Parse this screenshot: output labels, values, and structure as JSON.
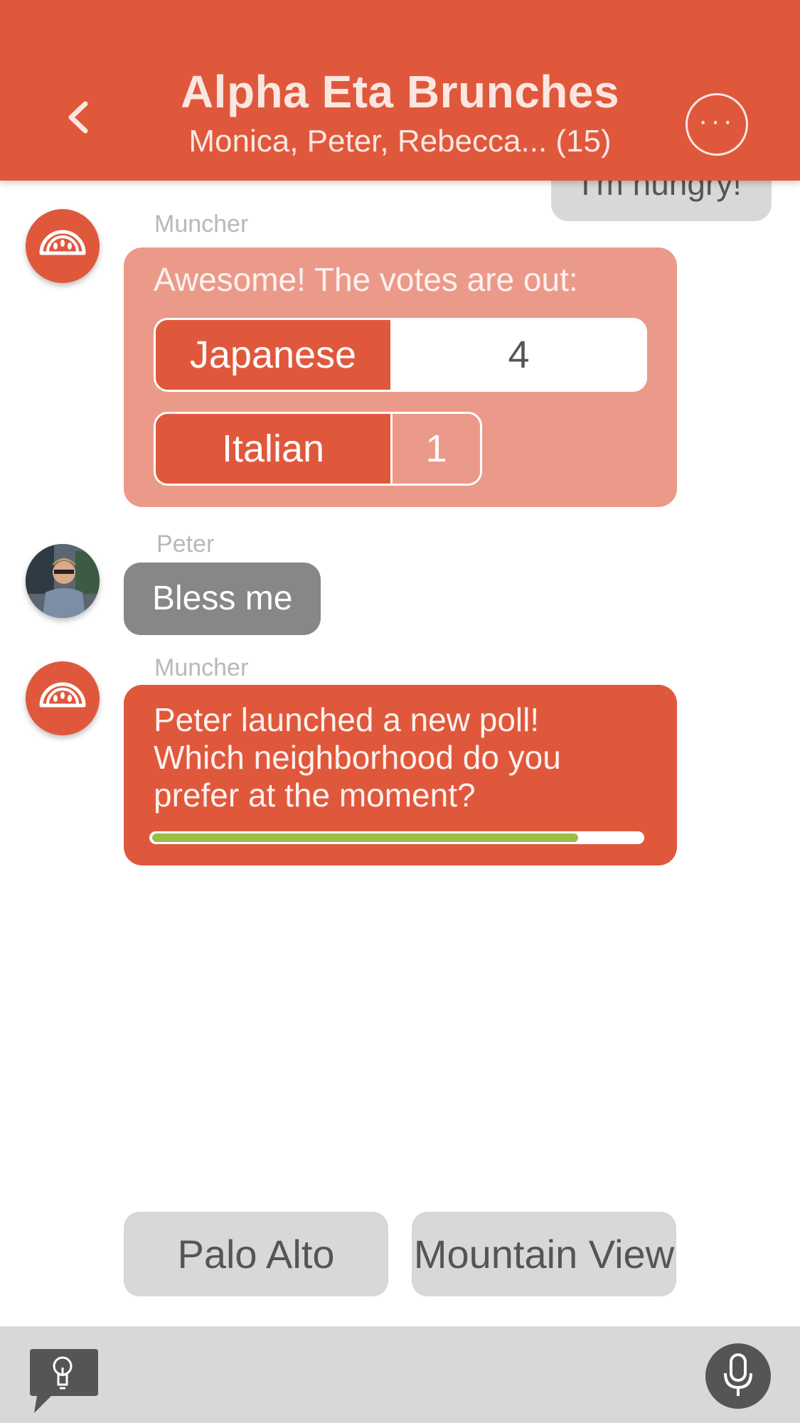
{
  "header": {
    "title": "Alpha Eta Brunches",
    "subtitle": "Monica, Peter, Rebecca... (15)",
    "more_label": "···"
  },
  "messages": {
    "previous_partial": "I'm hungry!",
    "bot_sender": "Muncher",
    "results_prompt": "Awesome! The votes are out:",
    "votes": [
      {
        "label": "Japanese",
        "count": "4"
      },
      {
        "label": "Italian",
        "count": "1"
      }
    ],
    "peter_sender": "Peter",
    "peter_text": "Bless me",
    "bot_sender_2": "Muncher",
    "poll_lines": [
      "Peter launched a new poll!",
      "Which neighborhood do you",
      "prefer at the moment?"
    ],
    "poll_progress": 0.87
  },
  "options": [
    "Palo Alto",
    "Mountain View"
  ],
  "icons": {
    "back": "chevron-left-icon",
    "more": "more-icon",
    "bot_logo": "watermelon-icon",
    "tips": "lightbulb-icon",
    "mic": "microphone-icon"
  },
  "colors": {
    "brand": "#e0583c",
    "results_bubble": "#eb9a8a",
    "user_bubble": "#878787",
    "option_bg": "#d8d8d8",
    "progress_fill": "#9cbc47"
  }
}
